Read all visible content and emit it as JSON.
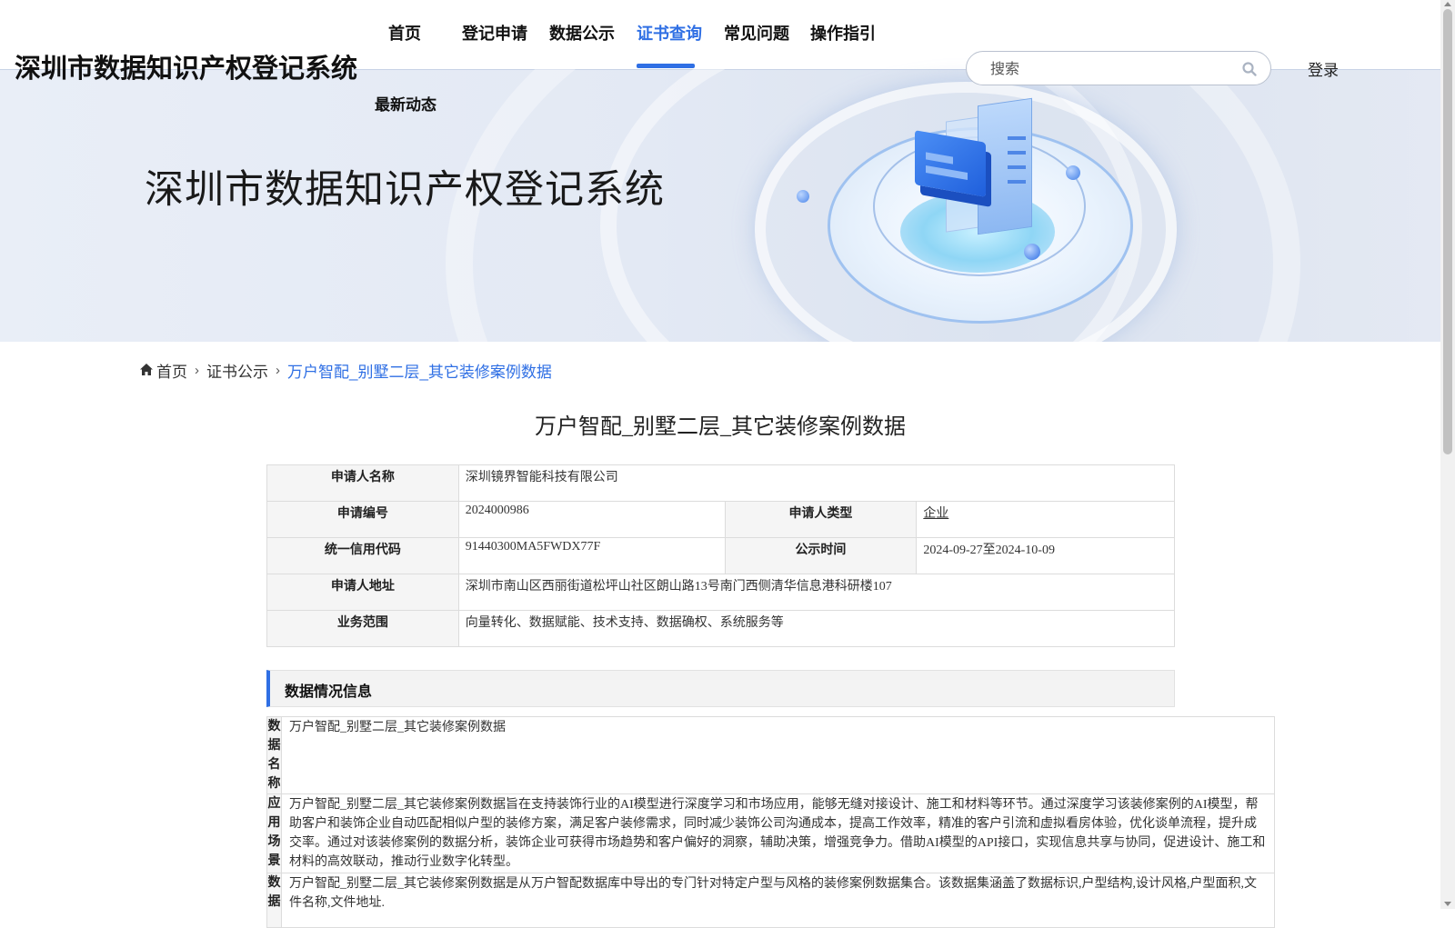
{
  "header": {
    "site_name": "深圳市数据知识产权登记系统",
    "nav": [
      {
        "label": "首页",
        "active": false
      },
      {
        "label": "登记申请",
        "active": false
      },
      {
        "label": "数据公示",
        "active": false
      },
      {
        "label": "证书查询",
        "active": true
      },
      {
        "label": "常见问题",
        "active": false
      },
      {
        "label": "操作指引",
        "active": false
      },
      {
        "label": "最新动态",
        "active": false
      }
    ],
    "search_placeholder": "搜索",
    "search_icon": "search-icon",
    "login_label": "登录"
  },
  "banner": {
    "title": "深圳市数据知识产权登记系统"
  },
  "breadcrumb": {
    "home_icon": "home-icon",
    "items": [
      "首页",
      "证书公示",
      "万户智配_别墅二层_其它装修案例数据"
    ]
  },
  "page_title": "万户智配_别墅二层_其它装修案例数据",
  "applicant": {
    "name_label": "申请人名称",
    "name": "深圳镜界智能科技有限公司",
    "number_label": "申请编号",
    "number": "2024000986",
    "type_label": "申请人类型",
    "type": "企业",
    "credit_code_label": "统一信用代码",
    "credit_code": "91440300MA5FWDX77F",
    "publicity_label": "公示时间",
    "publicity": "2024-09-27至2024-10-09",
    "address_label": "申请人地址",
    "address": "深圳市南山区西丽街道松坪山社区朗山路13号南门西侧清华信息港科研楼107",
    "scope_label": "业务范围",
    "scope": "向量转化、数据赋能、技术支持、数据确权、系统服务等"
  },
  "data_section": {
    "heading": "数据情况信息",
    "rows": [
      {
        "label": "数据名称",
        "value": "万户智配_别墅二层_其它装修案例数据"
      },
      {
        "label": "应用场景",
        "value": "万户智配_别墅二层_其它装修案例数据旨在支持装饰行业的AI模型进行深度学习和市场应用，能够无缝对接设计、施工和材料等环节。通过深度学习该装修案例的AI模型，帮助客户和装饰企业自动匹配相似户型的装修方案，满足客户装修需求，同时减少装饰公司沟通成本，提高工作效率，精准的客户引流和虚拟看房体验，优化谈单流程，提升成交率。通过对该装修案例的数据分析，装饰企业可获得市场趋势和客户偏好的洞察，辅助决策，增强竞争力。借助AI模型的API接口，实现信息共享与协同，促进设计、施工和材料的高效联动，推动行业数字化转型。"
      },
      {
        "label": "数据",
        "value": "万户智配_别墅二层_其它装修案例数据是从万户智配数据库中导出的专门针对特定户型与风格的装修案例数据集合。该数据集涵盖了数据标识,户型结构,设计风格,户型面积,文件名称,文件地址."
      }
    ]
  },
  "colors": {
    "accent": "#2f6fe4",
    "banner_bg": "#e3e9f4"
  }
}
